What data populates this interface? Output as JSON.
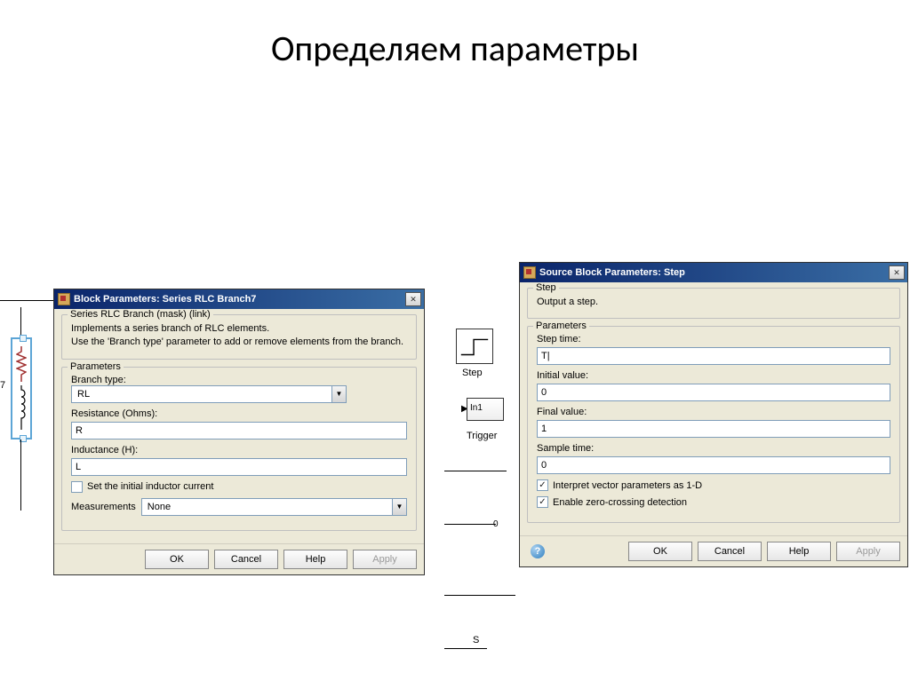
{
  "slide": {
    "title": "Определяем параметры"
  },
  "canvas": {
    "label7": "7",
    "step_label": "Step",
    "in1_label": "In1",
    "trigger_label": "Trigger",
    "s_label": "S",
    "out_port": "0"
  },
  "rlc_dialog": {
    "title": "Block Parameters: Series RLC Branch7",
    "mask_legend": "Series RLC Branch (mask) (link)",
    "desc_line1": "Implements a series branch of RLC elements.",
    "desc_line2": "Use the 'Branch type' parameter to add or remove elements from the branch.",
    "params_legend": "Parameters",
    "branch_type_label": "Branch type:",
    "branch_type_value": "RL",
    "resistance_label": "Resistance (Ohms):",
    "resistance_value": "R",
    "inductance_label": "Inductance (H):",
    "inductance_value": "L",
    "set_initial_label": "Set the initial inductor current",
    "measurements_label": "Measurements",
    "measurements_value": "None",
    "buttons": {
      "ok": "OK",
      "cancel": "Cancel",
      "help": "Help",
      "apply": "Apply"
    }
  },
  "step_dialog": {
    "title": "Source Block Parameters: Step",
    "step_legend": "Step",
    "step_desc": "Output a step.",
    "params_legend": "Parameters",
    "step_time_label": "Step time:",
    "step_time_value": "T|",
    "initial_value_label": "Initial value:",
    "initial_value": "0",
    "final_value_label": "Final value:",
    "final_value": "1",
    "sample_time_label": "Sample time:",
    "sample_time_value": "0",
    "interpret_label": "Interpret vector parameters as 1-D",
    "zero_crossing_label": "Enable zero-crossing detection",
    "buttons": {
      "ok": "OK",
      "cancel": "Cancel",
      "help": "Help",
      "apply": "Apply"
    }
  }
}
